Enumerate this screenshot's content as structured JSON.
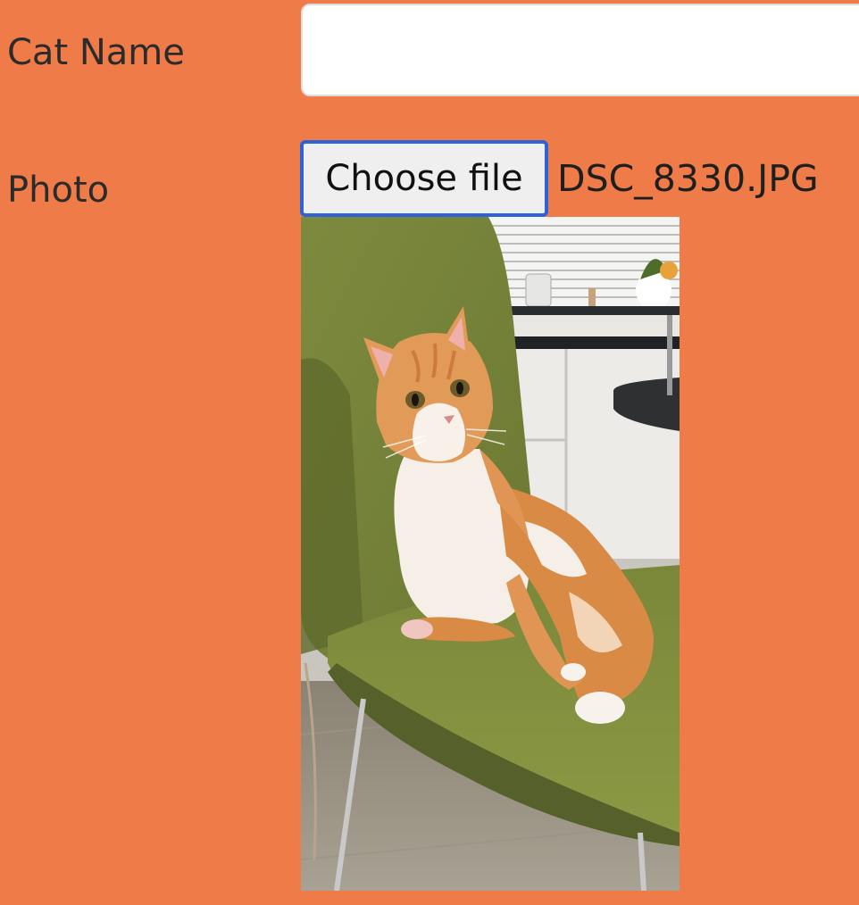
{
  "form": {
    "cat_name": {
      "label": "Cat Name",
      "value": ""
    },
    "photo": {
      "label": "Photo",
      "button_label": "Choose file",
      "file_name": "DSC_8330.JPG",
      "preview_icon": "cat-photo"
    }
  },
  "colors": {
    "page_background": "#ef7b49",
    "focus_ring": "#2e62d9"
  }
}
